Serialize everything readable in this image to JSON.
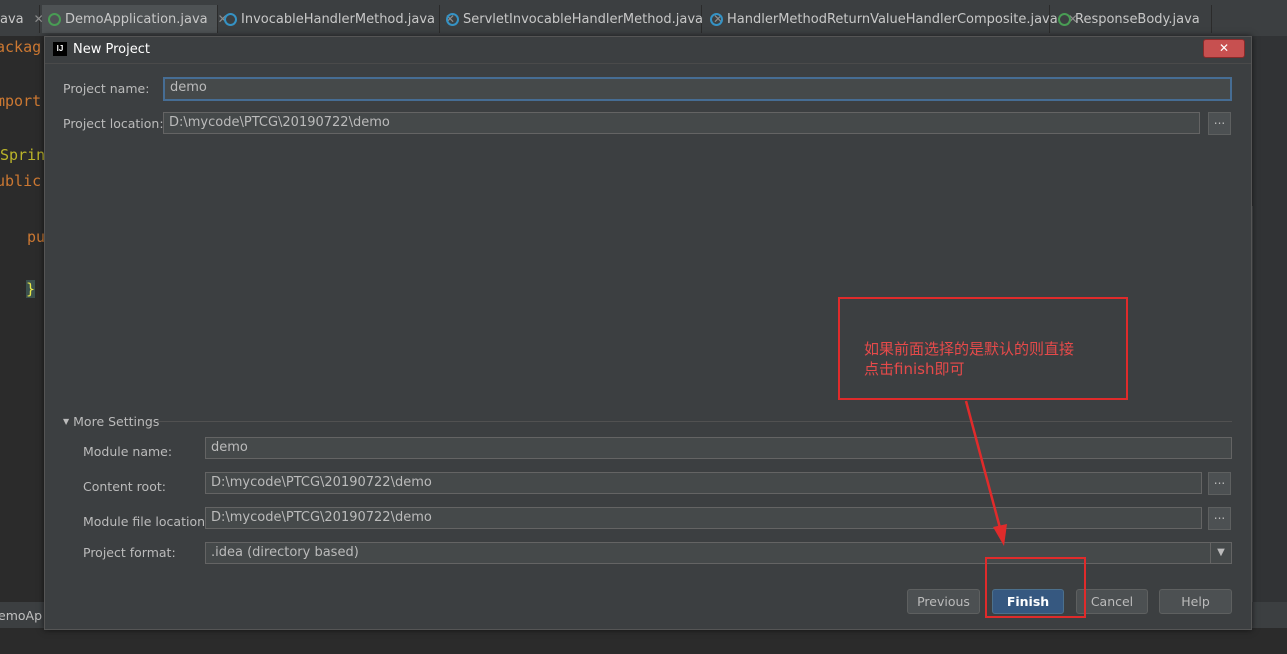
{
  "tabs": [
    {
      "label": "ava",
      "active": false,
      "icon": null,
      "close": "✕"
    },
    {
      "label": "DemoApplication.java",
      "active": true,
      "icon": "class-icon-green",
      "close": "✕"
    },
    {
      "label": "InvocableHandlerMethod.java",
      "active": false,
      "icon": "class-icon",
      "close": "✕"
    },
    {
      "label": "ServletInvocableHandlerMethod.java",
      "active": false,
      "icon": "class-icon",
      "close": "✕"
    },
    {
      "label": "HandlerMethodReturnValueHandlerComposite.java",
      "active": false,
      "icon": "class-icon",
      "close": "✕"
    },
    {
      "label": "ResponseBody.java",
      "active": false,
      "icon": "annotation-icon-green",
      "close": ""
    }
  ],
  "editor": {
    "lines": [
      "ackag",
      "mport",
      "Sprin",
      "ublic",
      "pu",
      "}"
    ],
    "status": "emoAp"
  },
  "dialog": {
    "title": "New Project",
    "logo": "IJ",
    "close_symbol": "✕",
    "project_name_label": "Project name:",
    "project_name_value": "demo",
    "project_location_label": "Project location:",
    "project_location_value": "D:\\mycode\\PTCG\\20190722\\demo",
    "browse_symbol": "...",
    "more_settings_label": "More Settings",
    "module_name_label": "Module name:",
    "module_name_value": "demo",
    "content_root_label": "Content root:",
    "content_root_value": "D:\\mycode\\PTCG\\20190722\\demo",
    "module_file_location_label": "Module file location:",
    "module_file_location_value": "D:\\mycode\\PTCG\\20190722\\demo",
    "project_format_label": "Project format:",
    "project_format_value": ".idea (directory based)",
    "buttons": {
      "previous": "Previous",
      "finish": "Finish",
      "cancel": "Cancel",
      "help": "Help"
    }
  },
  "annotation": {
    "line1": "如果前面选择的是默认的则直接",
    "line2": "点击finish即可",
    "color": "#e02b2b"
  },
  "colors": {
    "background": "#2b2b2b",
    "dialog": "#3c3f41",
    "default_button": "#365880",
    "focus_border": "#466d94"
  }
}
